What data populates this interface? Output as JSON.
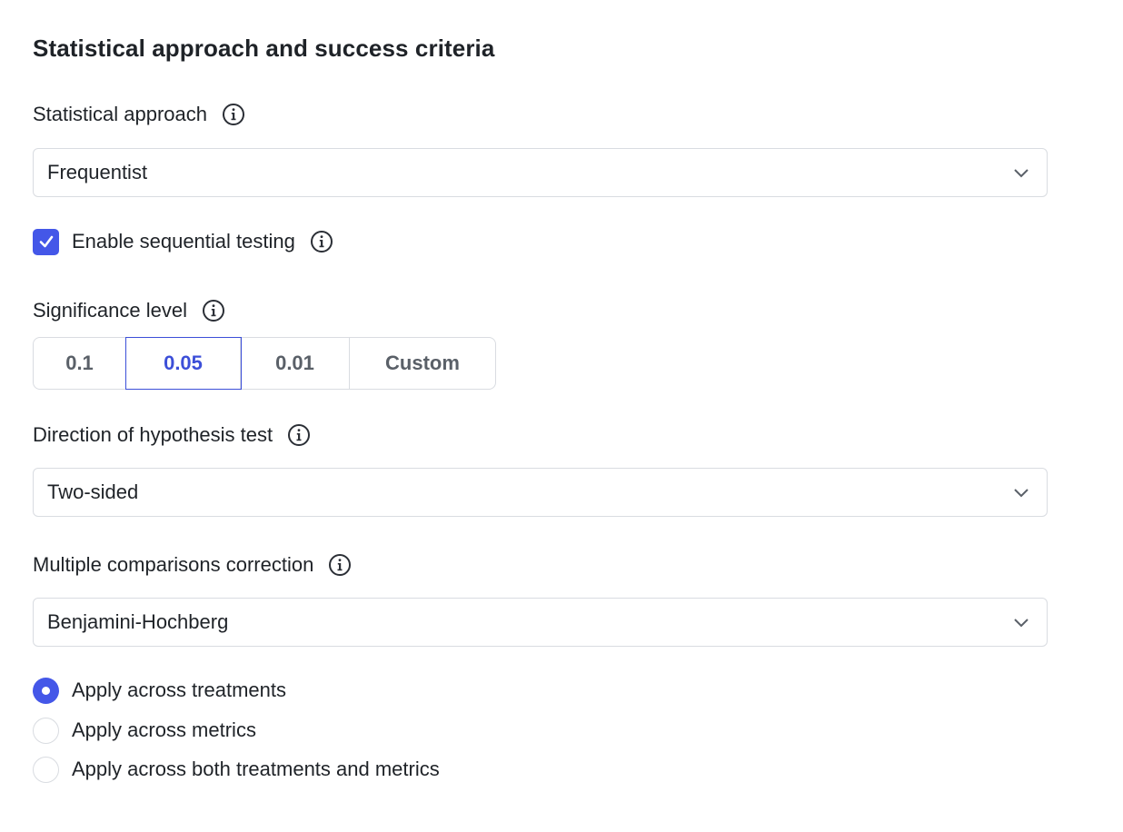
{
  "section": {
    "title": "Statistical approach and success criteria"
  },
  "statistical_approach": {
    "label": "Statistical approach",
    "value": "Frequentist"
  },
  "sequential_testing": {
    "label": "Enable sequential testing",
    "checked": true
  },
  "significance": {
    "label": "Significance level",
    "options": [
      "0.1",
      "0.05",
      "0.01",
      "Custom"
    ],
    "selected": "0.05"
  },
  "direction": {
    "label": "Direction of hypothesis test",
    "value": "Two-sided"
  },
  "correction": {
    "label": "Multiple comparisons correction",
    "value": "Benjamini-Hochberg",
    "options": [
      "Apply across treatments",
      "Apply across metrics",
      "Apply across both treatments and metrics"
    ],
    "selected": "Apply across treatments"
  },
  "colors": {
    "accent": "#4457e8",
    "border": "#d9dce1",
    "text": "#1f2328"
  }
}
